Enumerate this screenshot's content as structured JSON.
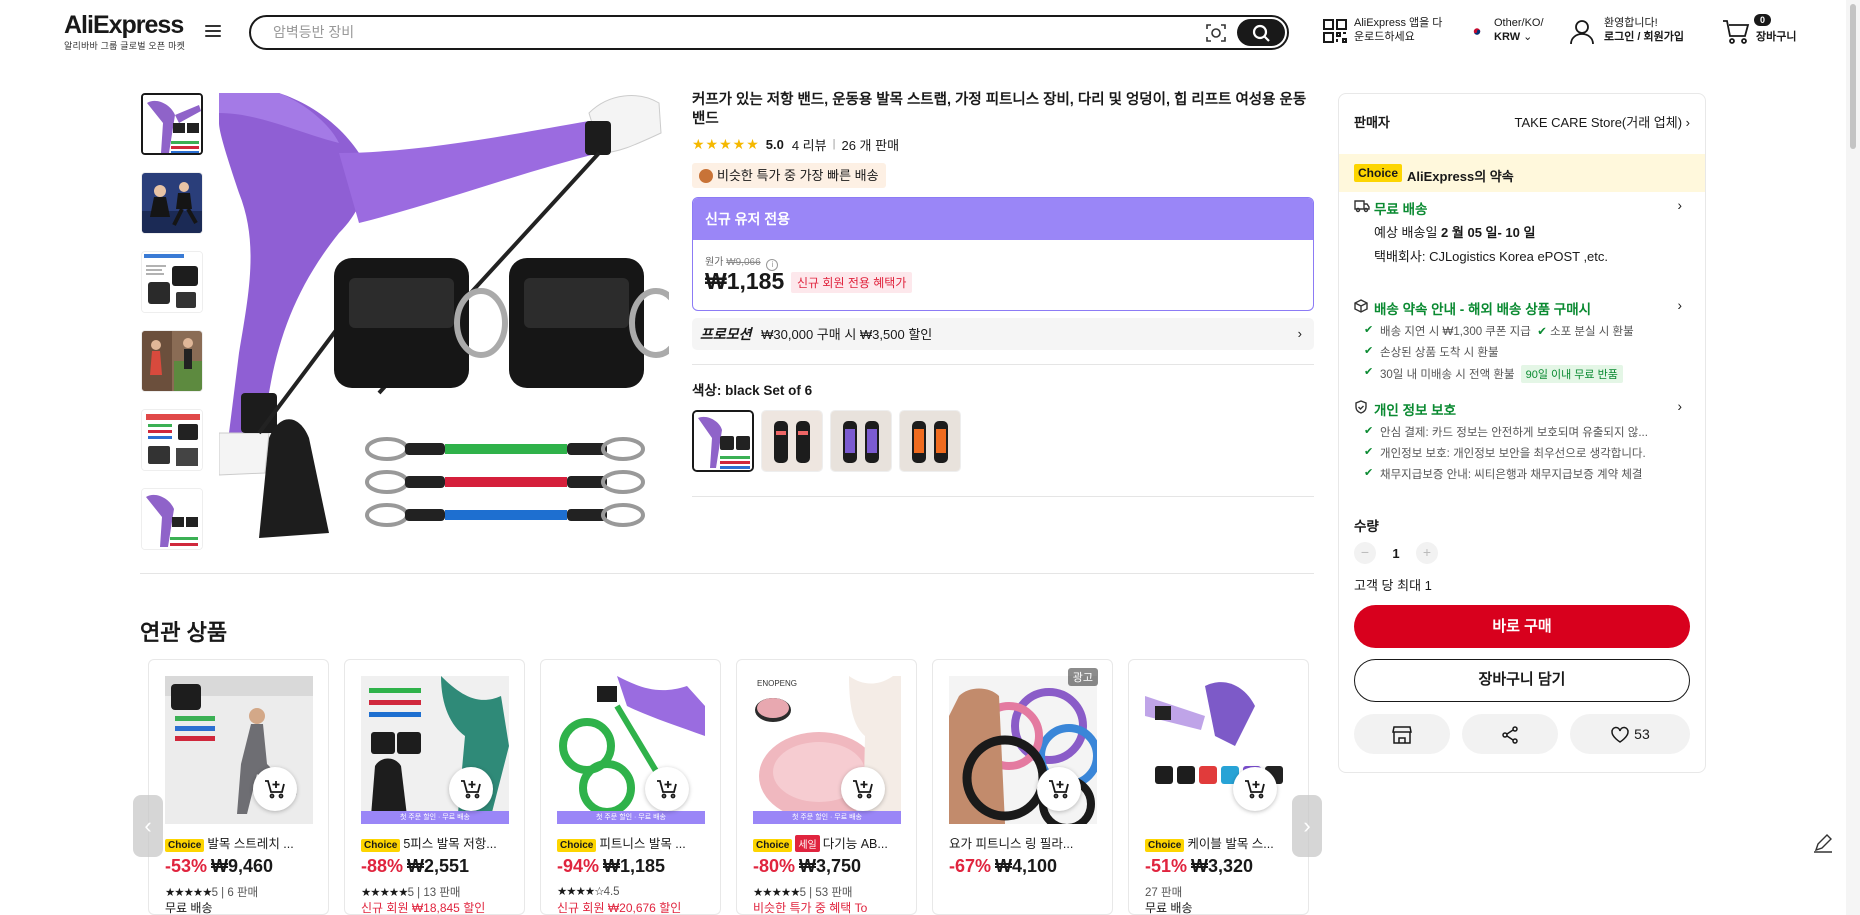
{
  "header": {
    "logo": "AliExpress",
    "logo_sub": "알리바바 그룹 글로벌 오픈 마켓",
    "search_placeholder": "암벽등반 장비",
    "app_download": [
      "AliExpress 앱을 다",
      "운로드하세요"
    ],
    "lang_line1": "Other/KO/",
    "lang_line2": "KRW",
    "user_line1": "환영합니다!",
    "user_line2": "로그인 / 회원가입",
    "cart_count": "0",
    "cart_label": "장바구니"
  },
  "product": {
    "title": "커프가 있는 저항 밴드, 운동용 발목 스트랩, 가정 피트니스 장비, 다리 및 엉덩이, 힙 리프트 여성용 운동 밴드",
    "rating_stars": "★★★★★",
    "rating_score": "5.0",
    "reviews": "4 리뷰",
    "sold": "26 개 판매",
    "fast_tag": "비슷한 특가 중 가장 빠른 배송",
    "newuser_head": "신규 유저 전용",
    "orig_label": "원가",
    "orig_price": "₩9,066",
    "price": "₩1,185",
    "price_tag": "신규 회원 전용 혜택가",
    "promo_label": "프로모션",
    "promo_text": "₩30,000 구매 시 ₩3,500 할인",
    "color_label": "색상:",
    "color_value": "black Set of 6"
  },
  "related": {
    "title": "연관 상품",
    "cards": [
      {
        "badge": "Choice",
        "name": "발목 스트레치 ...",
        "discount": "-53%",
        "price": "₩9,460",
        "stars": "★★★★★",
        "rating": "5",
        "sold": "6 판매",
        "ship": "무료 배송",
        "strip": "",
        "ad": ""
      },
      {
        "badge": "Choice",
        "name": "5피스 발목 저항...",
        "discount": "-88%",
        "price": "₩2,551",
        "stars": "★★★★★",
        "rating": "5",
        "sold": "13 판매",
        "ship": "신규 회원 ₩18,845 할인",
        "strip": "첫 주문 할인 · 무료 배송",
        "ad": ""
      },
      {
        "badge": "Choice",
        "name": "피트니스 발목 ...",
        "discount": "-94%",
        "price": "₩1,185",
        "stars": "★★★★☆",
        "rating": "4.5",
        "sold": "",
        "ship": "신규 회원 ₩20,676 할인",
        "strip": "첫 주문 할인 · 무료 배송",
        "ad": ""
      },
      {
        "badge": "Choice",
        "sale": "세일",
        "name": "다기능 AB...",
        "discount": "-80%",
        "price": "₩3,750",
        "stars": "★★★★★",
        "rating": "5",
        "sold": "53 판매",
        "ship": "비슷한 특가 중 혜택 To",
        "strip": "첫 주문 할인 · 무료 배송",
        "ad": ""
      },
      {
        "badge": "",
        "name": "요가 피트니스 링 필라...",
        "discount": "-67%",
        "price": "₩4,100",
        "stars": "",
        "rating": "",
        "sold": "",
        "ship": "",
        "strip": "",
        "ad": "광고"
      },
      {
        "badge": "Choice",
        "name": "케이블 발목 스...",
        "discount": "-51%",
        "price": "₩3,320",
        "stars": "",
        "rating": "",
        "sold": "27 판매",
        "ship": "무료 배송",
        "strip": "",
        "ad": ""
      }
    ]
  },
  "panel": {
    "seller_label": "판매자",
    "seller_name": "TAKE CARE Store(거래 업체)",
    "promise_badge": "Choice",
    "promise_title": "AliExpress의 약속",
    "free_ship": "무료 배송",
    "eta_label": "예상 배송일",
    "eta_value": "2 월 05 일- 10 일",
    "carrier": "택배회사:  CJLogistics   Korea ePOST ,etc.",
    "guarantee_head": "배송 약속 안내 - 해외 배송 상품 구매시",
    "g1": "배송 지연 시 ₩1,300 쿠폰 지급",
    "g1b": "소포 분실 시 환불",
    "g2": "손상된 상품 도착 시 환불",
    "g3": "30일 내 미배송 시 전액 환불",
    "g3_pill": "90일 이내 무료 반품",
    "privacy_head": "개인 정보 보호",
    "p1": "안심 결제: 카드 정보는 안전하게 보호되며 유출되지 않...",
    "p2": "개인정보 보호: 개인정보 보안을 최우선으로 생각합니다.",
    "p3": "채무지급보증 안내: 씨티은행과 채무지급보증 계약 체결",
    "qty_label": "수량",
    "qty": "1",
    "limit": "고객 당 최대 1",
    "buy": "바로 구매",
    "add_cart": "장바구니 담기",
    "wish_count": "53"
  },
  "colors": {
    "brand_red": "#d8001d",
    "purple": "#9a86f7",
    "green": "#0a8a31",
    "choice_yellow": "#fdd500"
  }
}
